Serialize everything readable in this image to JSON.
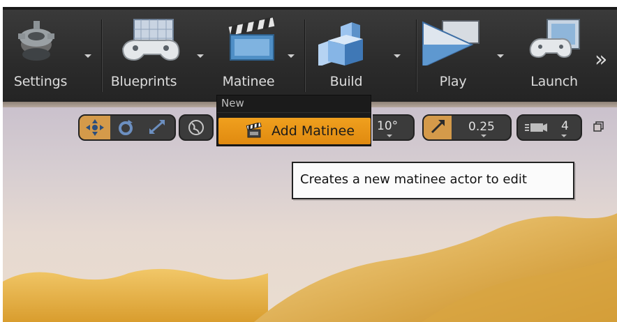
{
  "toolbar": {
    "settings_label": "Settings",
    "blueprints_label": "Blueprints",
    "matinee_label": "Matinee",
    "build_label": "Build",
    "play_label": "Play",
    "launch_label": "Launch",
    "overflow_glyph": "»"
  },
  "viewport_toolbar": {
    "rotation_snap": "10°",
    "scale_snap": "0.25",
    "camera_speed": "4"
  },
  "matinee_menu": {
    "section_label": "New",
    "add_item_label": "Add Matinee"
  },
  "tooltip": {
    "text": "Creates a new matinee actor to edit"
  },
  "colors": {
    "toolbar_bg": "#2b2b2b",
    "highlight": "#f0a01e",
    "label_text": "#dcdcdc",
    "terrain": "#e3b24a",
    "sky": "#d6cdd1"
  },
  "icons": [
    "settings-icon",
    "blueprints-icon",
    "matinee-icon",
    "build-icon",
    "play-icon",
    "launch-icon",
    "translate-icon",
    "rotate-icon",
    "scale-icon",
    "world-local-icon",
    "matinee-clapper-icon",
    "scale-snap-icon",
    "camera-speed-icon",
    "maximize-icon"
  ]
}
